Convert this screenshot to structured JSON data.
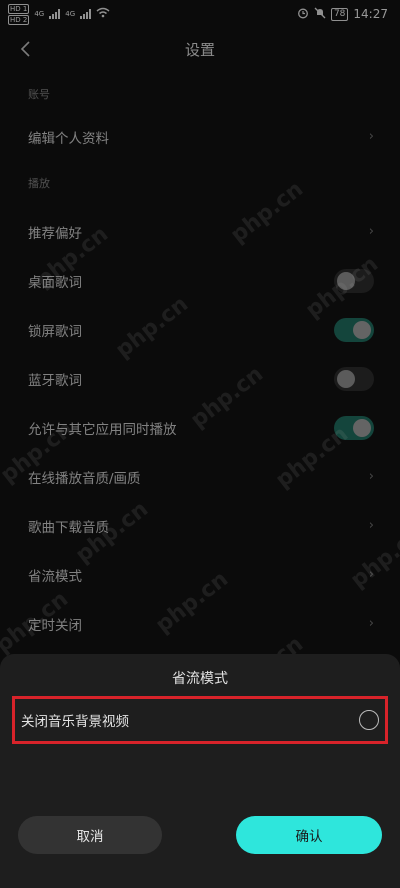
{
  "status_bar": {
    "hd1": "HD 1",
    "hd2": "HD 2",
    "net_4g": "4G",
    "net_4g_b": "4G",
    "battery": "78",
    "time": "14:27"
  },
  "header": {
    "title": "设置"
  },
  "settings": {
    "section_account": "账号",
    "edit_profile": "编辑个人资料",
    "section_playback": "播放",
    "recommend_prefs": "推荐偏好",
    "desktop_lyrics": "桌面歌词",
    "lockscreen_lyrics": "锁屏歌词",
    "bluetooth_lyrics": "蓝牙歌词",
    "allow_simultaneous": "允许与其它应用同时播放",
    "online_quality": "在线播放音质/画质",
    "download_quality": "歌曲下载音质",
    "data_saver": "省流模式",
    "sleep_timer": "定时关闭",
    "toggles": {
      "desktop_lyrics": false,
      "lockscreen_lyrics": true,
      "bluetooth_lyrics": false,
      "allow_simultaneous": true
    }
  },
  "sheet": {
    "title": "省流模式",
    "option_label": "关闭音乐背景视频",
    "option_selected": false,
    "cancel_label": "取消",
    "confirm_label": "确认"
  },
  "watermark": "php.cn",
  "colors": {
    "accent": "#2ee6dc",
    "toggle_on": "#1f6b5c",
    "highlight_border": "#d8232a"
  }
}
